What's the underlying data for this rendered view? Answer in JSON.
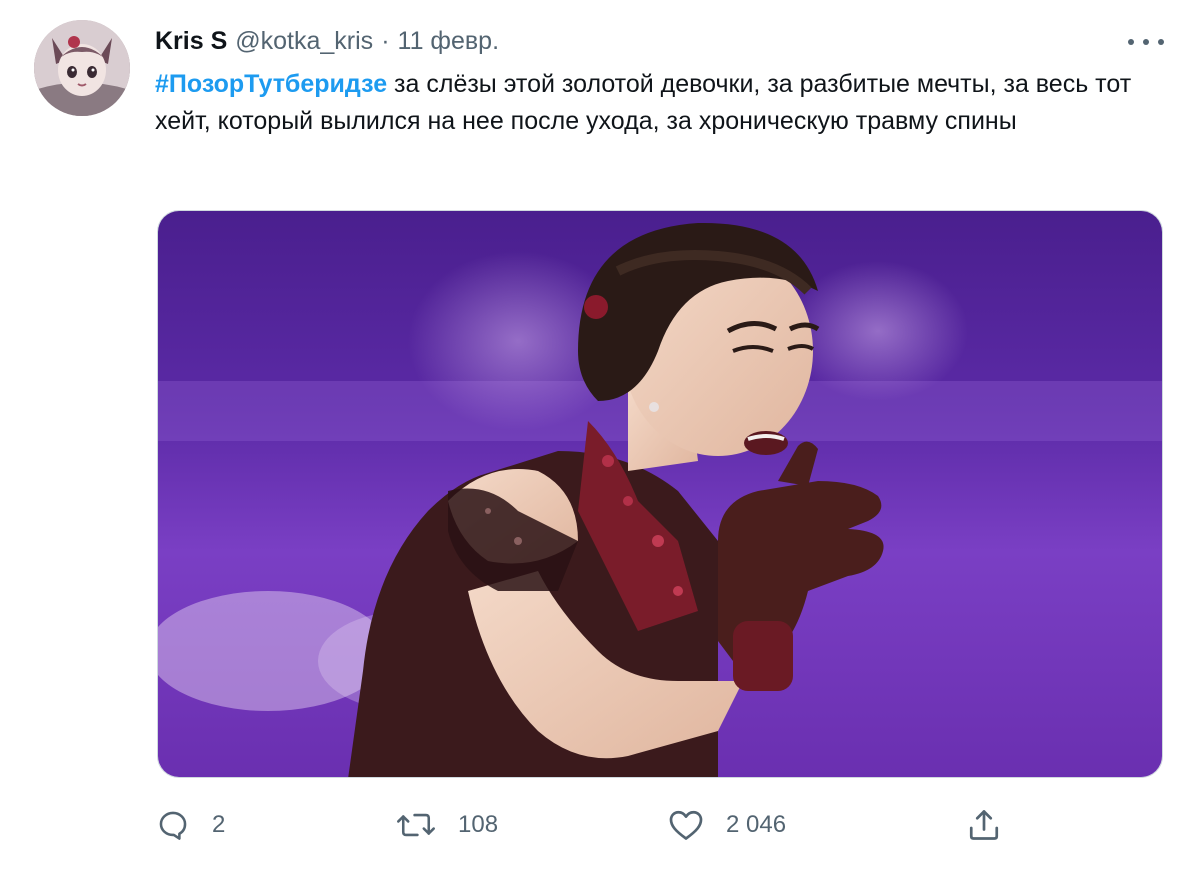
{
  "tweet": {
    "author_name": "Kris S",
    "author_handle": "@kotka_kris",
    "separator": "·",
    "date": "11 февр.",
    "hashtag": "#ПозорТутберидзе",
    "body": " за слёзы этой золотой девочки, за разбитые мечты, за весь тот хейт, который вылился на нее после ухода, за хроническую травму спины"
  },
  "actions": {
    "replies": "2",
    "retweets": "108",
    "likes": "2 046"
  },
  "icons": {
    "reply": "reply-icon",
    "retweet": "retweet-icon",
    "like": "heart-icon",
    "share": "share-icon",
    "more": "more-icon"
  },
  "colors": {
    "hashtag": "#1d9bf0",
    "secondary_text": "#536471",
    "media_background": "#6a2fb0"
  }
}
